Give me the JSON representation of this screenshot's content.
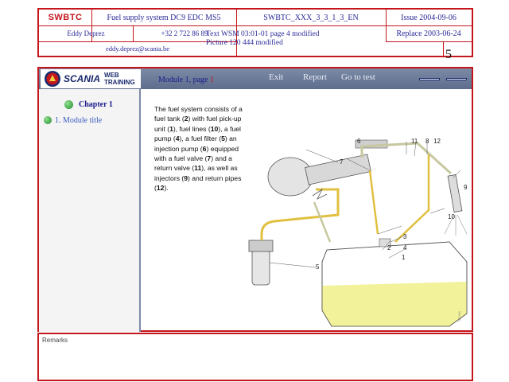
{
  "header": {
    "logo": "SWBTC",
    "title": "Fuel supply system DC9 EDC MS5",
    "doc_id": "SWBTC_XXX_3_3_1_3_EN",
    "issue": "Issue 2004-09-06",
    "author": "Eddy Deprez",
    "phone": "+32 2 722 86 89",
    "email": "eddy.deprez@scania.be",
    "note_line1": "Text WSM 03:01-01 page 4 modified",
    "note_line2": "Picture 120 444 modified",
    "replace": "Replace 2003-06-24",
    "page_number": "5"
  },
  "toolbar": {
    "brand": "SCANIA",
    "web": "WEB",
    "training": "TRAINING",
    "module_label": "Module 1, page ",
    "module_page": "1",
    "exit": "Exit",
    "report": "Report",
    "goto_test": "Go to test"
  },
  "sidebar": {
    "chapter": "Chapter 1",
    "module_title": "1. Module title"
  },
  "content": {
    "t1": "The fuel system consists of a fuel tank (",
    "n2": "2",
    "t2": ") with fuel pick-up unit (",
    "n1": "1",
    "t3": "), fuel lines (",
    "n10": "10",
    "t4": "), a fuel pump (",
    "n4": "4",
    "t5": "), a fuel filter (",
    "n5": "5",
    "t6": ") an injection pump (",
    "n6": "6",
    "t7": ") equipped with a fuel valve (",
    "n7": "7",
    "t8": ") and a return valve (",
    "n11": "11",
    "t9": "), as well as injectors (",
    "n9": "9",
    "t10": ") and return pipes (",
    "n12": "12",
    "t11": ")."
  },
  "diagram": {
    "labels": [
      "6",
      "11",
      "8",
      "12",
      "7",
      "9",
      "10",
      "4",
      "3",
      "2",
      "1",
      "5"
    ],
    "ref": "120 444"
  },
  "remarks": {
    "label": "Remarks"
  },
  "colors": {
    "frame": "#c4161c",
    "toolbar": "#6f7e9c",
    "fuel_line": "#e0c040",
    "tank_fuel": "#f2f29a"
  }
}
